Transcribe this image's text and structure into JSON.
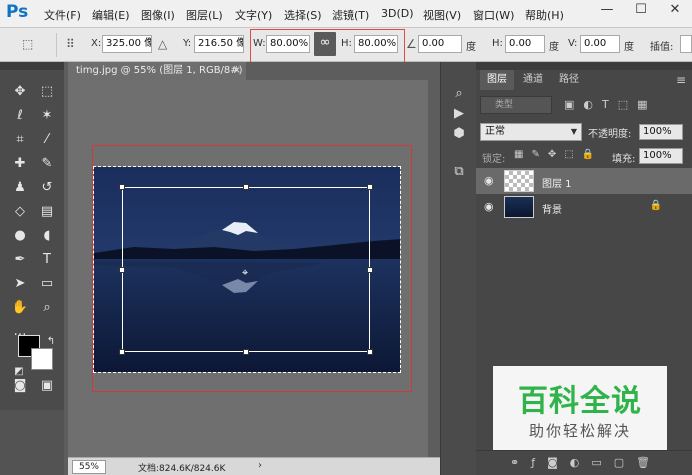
{
  "app": {
    "logo": "Ps",
    "menu": [
      "文件(F)",
      "编辑(E)",
      "图像(I)",
      "图层(L)",
      "文字(Y)",
      "选择(S)",
      "滤镜(T)",
      "3D(D)",
      "视图(V)",
      "窗口(W)",
      "帮助(H)"
    ],
    "window_controls": {
      "minimize": "—",
      "maximize": "☐",
      "close": "✕"
    }
  },
  "options": {
    "x_label": "X:",
    "x_value": "325.00 像素",
    "y_label": "Y:",
    "y_value": "216.50 像素",
    "w_label": "W:",
    "w_value": "80.00%",
    "link_glyph": "∞",
    "h_label": "H:",
    "h_value": "80.00%",
    "angle_value": "0.00",
    "angle_unit": "度",
    "hskew_label": "H:",
    "hskew_value": "0.00",
    "hskew_unit": "度",
    "vskew_label": "V:",
    "vskew_value": "0.00",
    "vskew_unit": "度",
    "interp_label": "插值:"
  },
  "document": {
    "tab_title": "timg.jpg @ 55% (图层 1, RGB/8#) *",
    "tab_close": "×",
    "zoom": "55%",
    "doc_info": "文档:824.6K/824.6K",
    "status_arrow": "›"
  },
  "layers_panel": {
    "tabs": [
      "图层",
      "通道",
      "路径"
    ],
    "active_tab": 0,
    "menu_glyph": "≡",
    "filter_placeholder": "类型",
    "blend_mode": "正常",
    "opacity_label": "不透明度:",
    "opacity_value": "100%",
    "lock_label": "锁定:",
    "fill_label": "填充:",
    "fill_value": "100%",
    "layers": [
      {
        "name": "图层 1",
        "selected": true,
        "thumb": "transparent",
        "locked": false
      },
      {
        "name": "背景",
        "selected": false,
        "thumb": "photo",
        "locked": true
      }
    ]
  },
  "watermark": {
    "main": "百科全说",
    "sub": "助你轻松解决"
  },
  "colors": {
    "ps_blue": "#0f74c8",
    "highlight_red": "#e04a4a",
    "watermark_green": "#2fb34a"
  }
}
